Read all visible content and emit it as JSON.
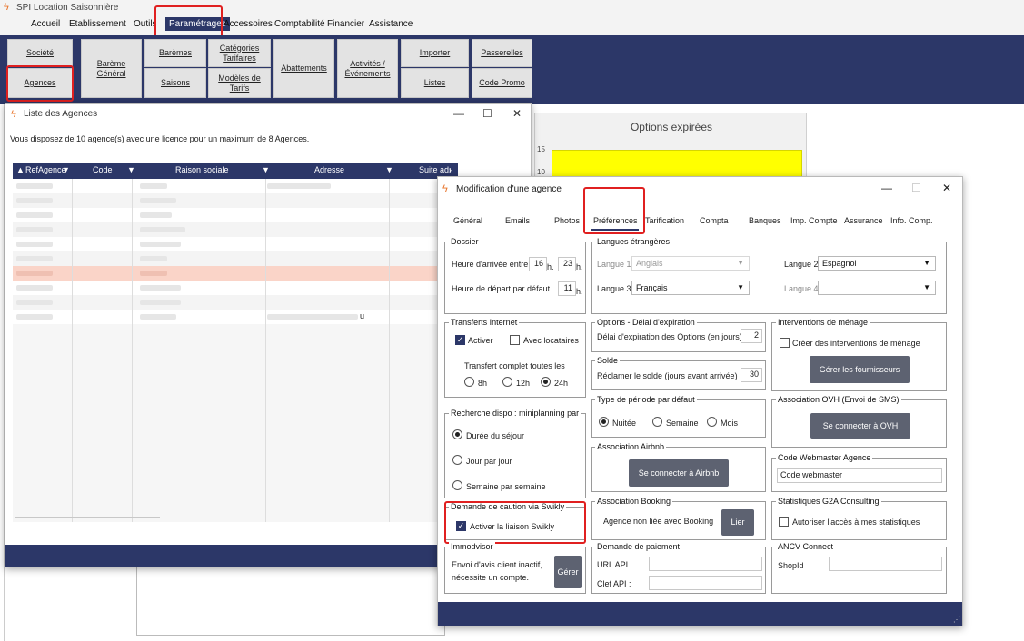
{
  "app": {
    "title": "SPI Location Saisonnière"
  },
  "menu": [
    "Accueil",
    "Etablissement",
    "Outils",
    "Paramétrages",
    "Accessoires",
    "Comptabilité",
    "Financier",
    "Assistance"
  ],
  "ribbon": {
    "societe": "Société",
    "agences": "Agences",
    "bareme_general": "Barème Général",
    "baremes": "Barèmes",
    "saisons": "Saisons",
    "categories_tarifaires": "Catégories Tarifaires",
    "modeles_tarifs": "Modèles de Tarifs",
    "abattements": "Abattements",
    "activites": "Activités / Événements",
    "importer": "Importer",
    "listes": "Listes",
    "passerelles": "Passerelles",
    "code_promo": "Code Promo"
  },
  "background": {
    "options_title": "Options expirées",
    "y_ticks": [
      "15",
      "10"
    ]
  },
  "agences_window": {
    "title": "Liste des Agences",
    "notice": "Vous disposez de 10 agence(s) avec une licence pour un maximum de 8 Agences.",
    "columns": [
      "RefAgence",
      "Code",
      "Raison sociale",
      "Adresse",
      "Suite adı"
    ],
    "visible_fragment": "u"
  },
  "modif": {
    "title": "Modification d'une agence",
    "tabs": [
      "Général",
      "Emails",
      "Photos",
      "Préférences",
      "Tarification",
      "Compta",
      "Banques",
      "Imp. Compte",
      "Assurance",
      "Info. Comp."
    ],
    "dossier": {
      "title": "Dossier",
      "arrivee_label": "Heure d'arrivée entre",
      "arrivee_h1": "16",
      "arrivee_h2": "23",
      "h": "h.",
      "depart_label": "Heure de départ par défaut",
      "depart_h": "11"
    },
    "langues": {
      "title": "Langues étrangères",
      "l1_label": "Langue 1",
      "l1_value": "Anglais",
      "l2_label": "Langue 2",
      "l2_value": "Espagnol",
      "l3_label": "Langue 3",
      "l3_value": "Français",
      "l4_label": "Langue 4",
      "l4_value": ""
    },
    "transferts": {
      "title": "Transferts Internet",
      "activer": "Activer",
      "avec_locataires": "Avec locataires",
      "complet": "Transfert complet toutes les",
      "r8": "8h",
      "r12": "12h",
      "r24": "24h"
    },
    "options": {
      "title": "Options  -  Délai d'expiration",
      "label": "Délai d'expiration des Options (en jours)",
      "value": "2"
    },
    "solde": {
      "title": "Solde",
      "label": "Réclamer le solde (jours avant arrivée)",
      "value": "30"
    },
    "menage": {
      "title": "Interventions de ménage",
      "check": "Créer des interventions de ménage",
      "button": "Gérer les fournisseurs"
    },
    "ovh": {
      "title": "Association OVH (Envoi de SMS)",
      "button": "Se connecter à OVH"
    },
    "recherche": {
      "title": "Recherche dispo : miniplanning par",
      "o1": "Durée du séjour",
      "o2": "Jour par jour",
      "o3": "Semaine par semaine"
    },
    "periode": {
      "title": "Type de période par défaut",
      "o1": "Nuitée",
      "o2": "Semaine",
      "o3": "Mois"
    },
    "airbnb": {
      "title": "Association Airbnb",
      "button": "Se connecter à Airbnb"
    },
    "webmaster": {
      "title": "Code Webmaster Agence",
      "placeholder": "Code webmaster"
    },
    "swikly": {
      "title": "Demande de caution via Swikly",
      "check": "Activer la liaison Swikly"
    },
    "booking": {
      "title": "Association Booking",
      "status": "Agence non liée avec Booking",
      "button": "Lier"
    },
    "g2a": {
      "title": "Statistiques G2A Consulting",
      "check": "Autoriser l'accès à mes statistiques"
    },
    "immodvisor": {
      "title": "Immodvisor",
      "text1": "Envoi d'avis client inactif,",
      "text2": "nécessite un compte.",
      "button": "Gérer"
    },
    "paiement": {
      "title": "Demande de paiement",
      "url": "URL API",
      "clef": "Clef API :"
    },
    "ancv": {
      "title": "ANCV Connect",
      "shopid": "ShopId"
    }
  }
}
